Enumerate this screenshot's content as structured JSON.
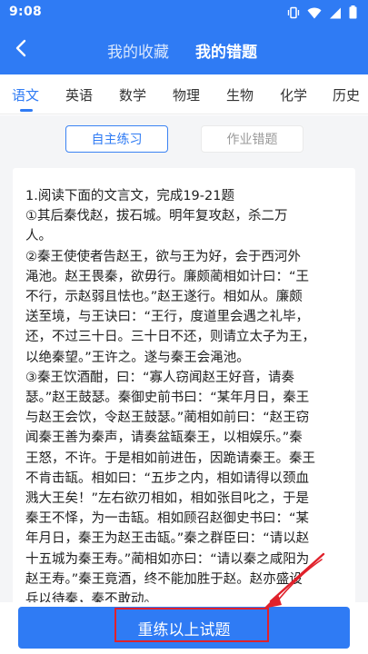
{
  "status_bar": {
    "time": "9:08"
  },
  "header": {
    "tab_favorites": "我的收藏",
    "tab_mistakes": "我的错题"
  },
  "subjects": [
    "语文",
    "英语",
    "数学",
    "物理",
    "生物",
    "化学",
    "历史"
  ],
  "modes": {
    "self_practice": "自主练习",
    "homework_mistakes": "作业错题"
  },
  "question": {
    "lines": [
      "1.阅读下面的文言文，完成19-21题",
      "  ①其后秦伐赵，拔石城。明年复攻赵，杀二万",
      "人。",
      "  ②秦王使使者告赵王，欲与王为好，会于西河外",
      "渑池。赵王畏秦，欲毋行。廉颇蔺相如计曰：“王",
      "不行，示赵弱且怯也。”赵王遂行。相如从。廉颇",
      "送至境，与王诀曰：“王行，度道里会遇之礼毕，",
      "还，不过三十日。三十日不还，则请立太子为王，",
      "以绝秦望。”王许之。遂与秦王会渑池。",
      "  ③秦王饮酒酣，曰：“寡人窃闻赵王好音，请奏",
      "瑟。”赵王鼓瑟。秦御史前书曰：“某年月日，秦王",
      "与赵王会饮，令赵王鼓瑟。”蔺相如前曰：“赵王窃",
      "闻秦王善为秦声，请奏盆缻秦王，以相娱乐。”秦",
      "王怒，不许。于是相如前进缶，因跪请秦王。秦王",
      "不肯击缻。相如曰：“五步之内，相如请得以颈血",
      "溅大王矣！”左右欲刃相如，相如张目叱之，于是",
      "秦王不怿，为一击缻。相如顾召赵御史书曰：“某",
      "年月日，秦王为赵王击缻。”秦之群臣曰：“请以赵",
      "十五城为秦王寿。”蔺相如亦曰：“请以秦之咸阳为",
      "赵王寿。”秦王竟酒，终不能加胜于赵。赵亦盛设",
      "兵以待秦，秦不敢动。"
    ]
  },
  "bottom": {
    "retry_label": "重练以上试题"
  },
  "colors": {
    "primary": "#2f7bf4",
    "annotation": "#e0212b"
  }
}
